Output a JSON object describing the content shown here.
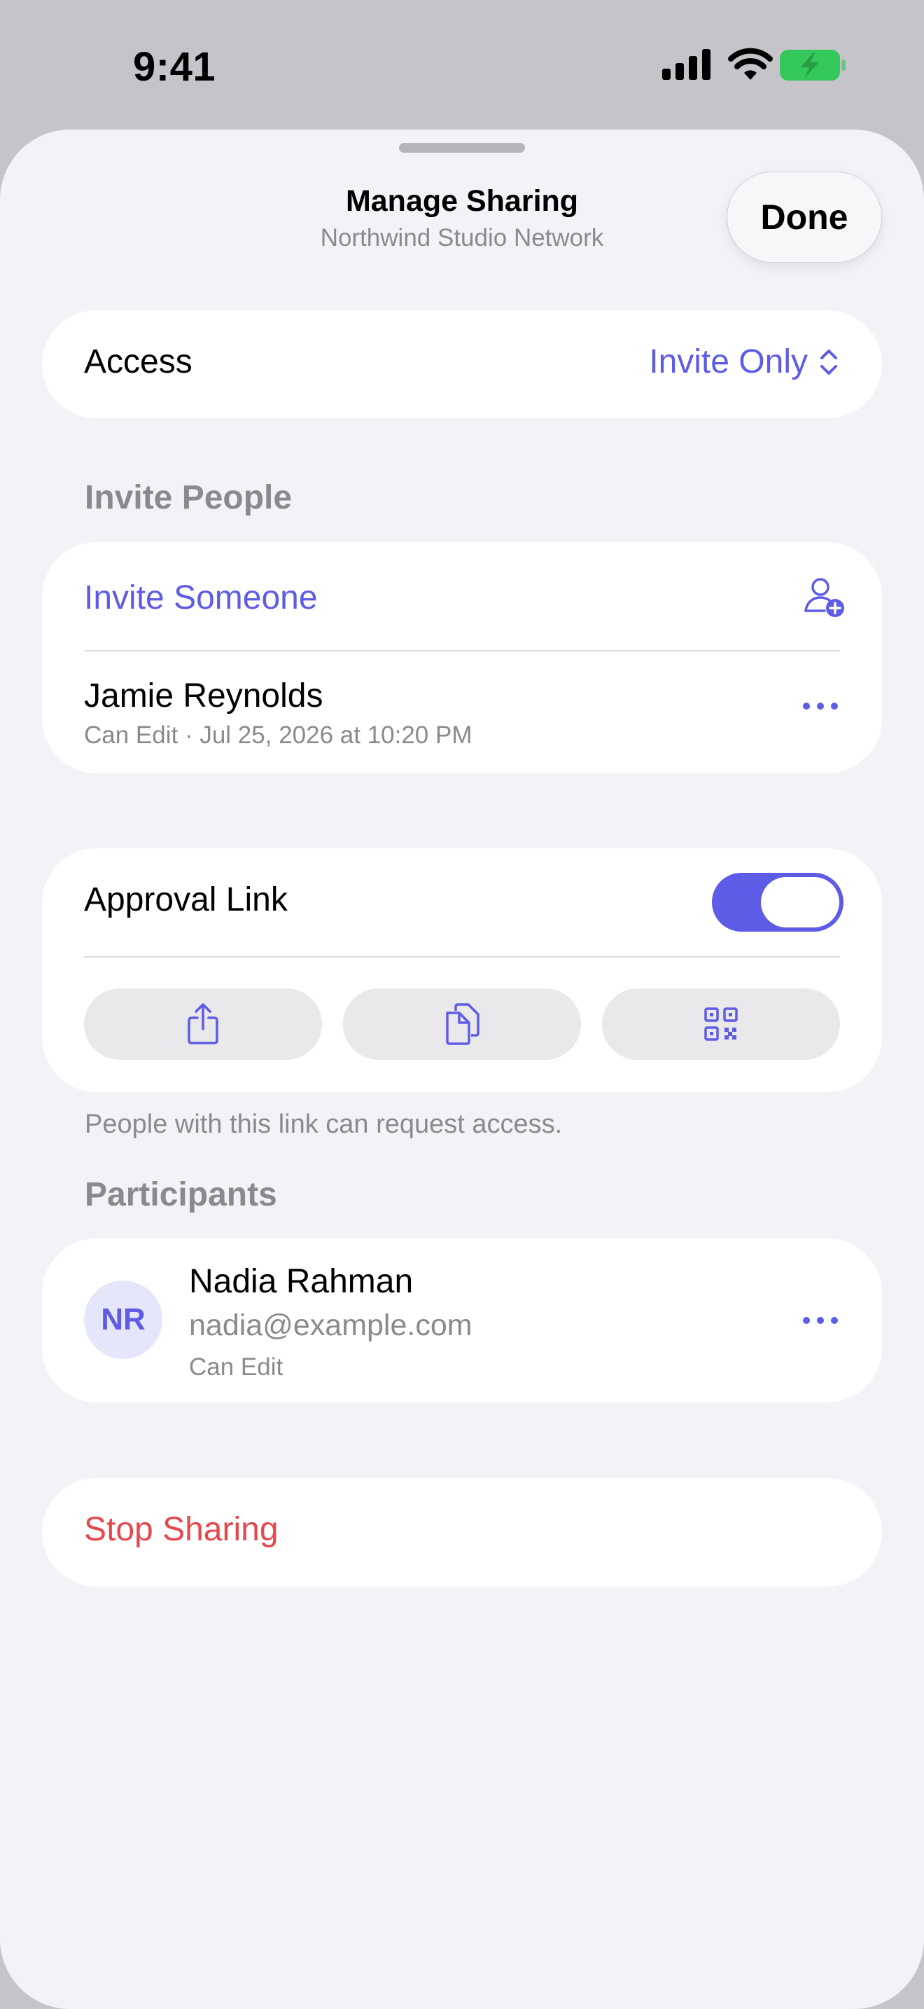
{
  "status_bar": {
    "time": "9:41",
    "icons": [
      "cellular-signal-icon",
      "wifi-icon",
      "battery-charging-icon"
    ],
    "battery_color": "#34c759"
  },
  "sheet": {
    "title": "Manage Sharing",
    "subtitle": "Northwind Studio Network",
    "done_label": "Done"
  },
  "access": {
    "label": "Access",
    "value": "Invite Only"
  },
  "invite_people": {
    "header": "Invite People",
    "invite_label": "Invite Someone",
    "invitee": {
      "name": "Jamie Reynolds",
      "detail": "Can Edit · Jul 25, 2026 at 10:20 PM"
    }
  },
  "approval_link": {
    "label": "Approval Link",
    "enabled": true,
    "actions": [
      "share-icon",
      "copy-icon",
      "qr-code-icon"
    ],
    "footnote": "People with this link can request access."
  },
  "participants": {
    "header": "Participants",
    "items": [
      {
        "initials": "NR",
        "name": "Nadia Rahman",
        "email": "nadia@example.com",
        "role": "Can Edit"
      }
    ]
  },
  "stop_sharing_label": "Stop Sharing",
  "colors": {
    "accent": "#5e5ce6",
    "destructive": "#e5484d",
    "secondary_text": "#8a8a8e",
    "background": "#f2f2f7"
  }
}
